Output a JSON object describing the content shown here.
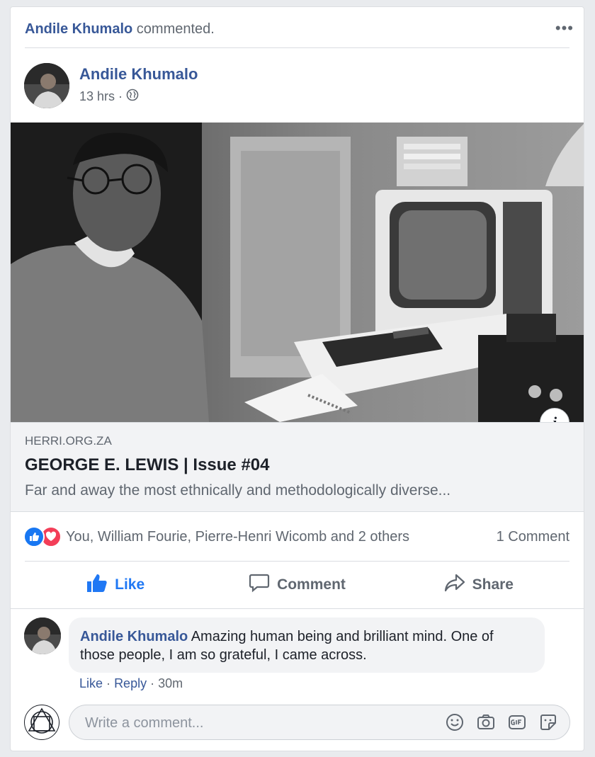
{
  "activity": {
    "actor": "Andile Khumalo",
    "action": "commented."
  },
  "post": {
    "author": "Andile Khumalo",
    "time": "13 hrs",
    "separator": "·",
    "link": {
      "domain": "HERRI.ORG.ZA",
      "title": "GEORGE E. LEWIS | Issue #04",
      "description": "Far and away the most ethnically and methodologically diverse..."
    },
    "reactions_text": "You, William Fourie, Pierre-Henri Wicomb and 2 others",
    "comment_count": "1 Comment"
  },
  "actions": {
    "like": "Like",
    "comment": "Comment",
    "share": "Share"
  },
  "comment": {
    "author": "Andile Khumalo",
    "text_line1": "Amazing human being and brilliant mind. One of",
    "text_line2": "those people, I am so grateful, I came across.",
    "like": "Like",
    "reply": "Reply",
    "dot": "·",
    "time": "30m"
  },
  "composer": {
    "placeholder": "Write a comment..."
  },
  "colors": {
    "link_blue": "#385898",
    "like_blue": "#2078f4",
    "love_red": "#f33e58",
    "muted": "#606770"
  }
}
